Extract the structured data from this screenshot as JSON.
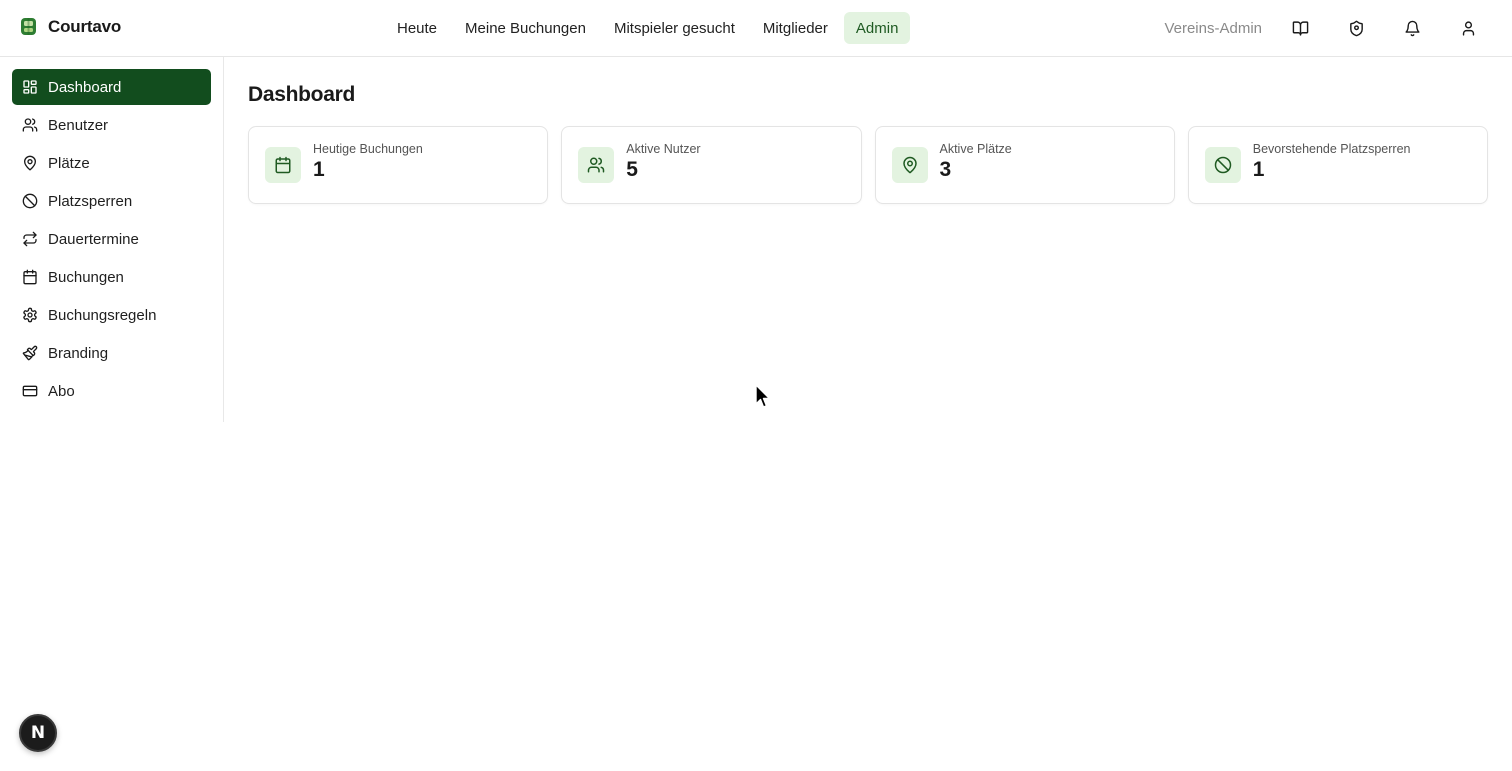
{
  "app": {
    "name": "Courtavo",
    "brand_color": "#124d1e",
    "accent_bg": "#e3f3e0"
  },
  "topnav": {
    "items": [
      {
        "label": "Heute",
        "active": false
      },
      {
        "label": "Meine Buchungen",
        "active": false
      },
      {
        "label": "Mitspieler gesucht",
        "active": false
      },
      {
        "label": "Mitglieder",
        "active": false
      },
      {
        "label": "Admin",
        "active": true
      }
    ]
  },
  "header_right": {
    "role_label": "Vereins-Admin",
    "icons": [
      "book-icon",
      "shield-icon",
      "bell-icon",
      "user-icon"
    ]
  },
  "sidebar": {
    "items": [
      {
        "label": "Dashboard",
        "icon": "dashboard-icon",
        "active": true
      },
      {
        "label": "Benutzer",
        "icon": "users-icon",
        "active": false
      },
      {
        "label": "Plätze",
        "icon": "map-pin-icon",
        "active": false
      },
      {
        "label": "Platzsperren",
        "icon": "ban-icon",
        "active": false
      },
      {
        "label": "Dauertermine",
        "icon": "repeat-icon",
        "active": false
      },
      {
        "label": "Buchungen",
        "icon": "calendar-icon",
        "active": false
      },
      {
        "label": "Buchungsregeln",
        "icon": "gear-icon",
        "active": false
      },
      {
        "label": "Branding",
        "icon": "paintbrush-icon",
        "active": false
      },
      {
        "label": "Abo",
        "icon": "credit-card-icon",
        "active": false
      }
    ]
  },
  "main": {
    "title": "Dashboard",
    "stats": [
      {
        "label": "Heutige Buchungen",
        "value": "1",
        "icon": "calendar-icon"
      },
      {
        "label": "Aktive Nutzer",
        "value": "5",
        "icon": "users-icon"
      },
      {
        "label": "Aktive Plätze",
        "value": "3",
        "icon": "map-pin-icon"
      },
      {
        "label": "Bevorstehende Platzsperren",
        "value": "1",
        "icon": "ban-icon"
      }
    ]
  },
  "dev_badge": {
    "letter": "N"
  }
}
